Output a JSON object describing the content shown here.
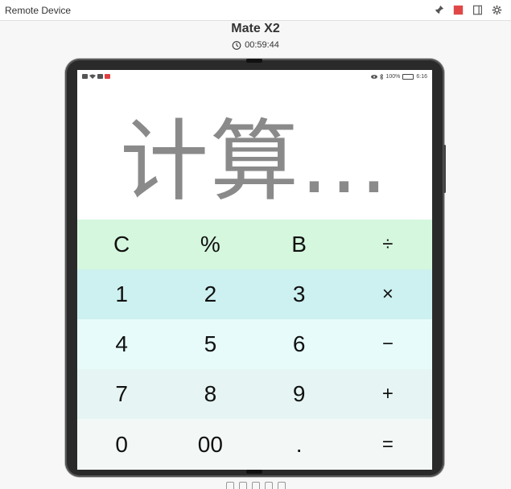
{
  "window": {
    "title": "Remote Device",
    "tools": [
      {
        "icon": "pin-icon"
      },
      {
        "icon": "record-icon",
        "color": "#e04848"
      },
      {
        "icon": "panel-icon"
      },
      {
        "icon": "gear-icon"
      }
    ]
  },
  "device": {
    "name": "Mate X2",
    "timer": "00:59:44"
  },
  "statusbar": {
    "battery": "100%",
    "time": "6:16"
  },
  "display": {
    "text": "计算..."
  },
  "keypad": {
    "rows": [
      {
        "color": "#d5f7de",
        "keys": [
          "C",
          "%",
          "B",
          "÷"
        ]
      },
      {
        "color": "#cdf0f0",
        "keys": [
          "1",
          "2",
          "3",
          "×"
        ]
      },
      {
        "color": "#e8fbfb",
        "keys": [
          "4",
          "5",
          "6",
          "−"
        ]
      },
      {
        "color": "#e6f5f3",
        "keys": [
          "7",
          "8",
          "9",
          "+"
        ]
      },
      {
        "color": "#f3f8f7",
        "keys": [
          "0",
          "00",
          ".",
          "="
        ]
      }
    ]
  }
}
